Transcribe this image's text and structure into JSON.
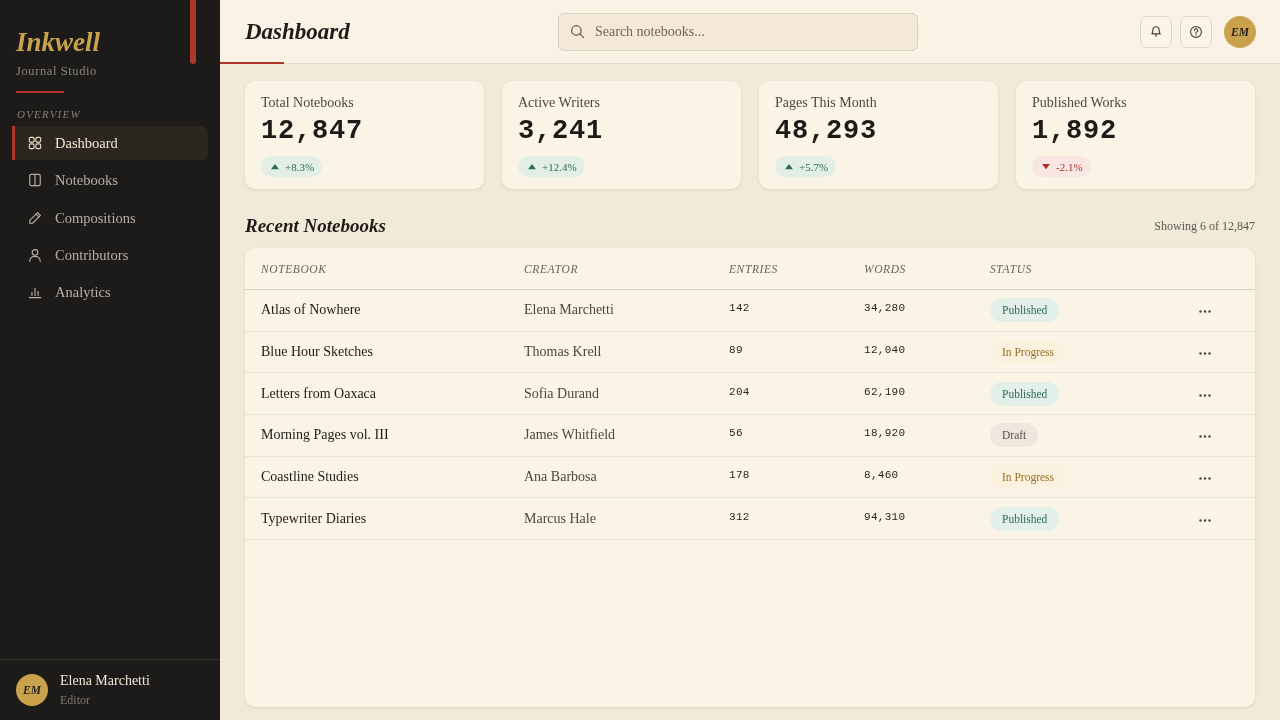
{
  "sidebar": {
    "logo": "Inkwell",
    "tagline": "Journal Studio",
    "section_label": "OVERVIEW",
    "items": [
      {
        "label": "Dashboard",
        "selected": true
      },
      {
        "label": "Notebooks",
        "selected": false
      },
      {
        "label": "Compositions",
        "selected": false
      },
      {
        "label": "Contributors",
        "selected": false
      },
      {
        "label": "Analytics",
        "selected": false
      }
    ],
    "user": {
      "initials": "EM",
      "name": "Elena Marchetti",
      "role": "Editor"
    }
  },
  "header": {
    "title": "Dashboard",
    "search": {
      "placeholder": "Search notebooks..."
    },
    "avatar": {
      "initials": "EM"
    }
  },
  "stats": [
    {
      "label": "Total Notebooks",
      "value": "12,847",
      "change": "+8.3%",
      "kind": "up"
    },
    {
      "label": "Active Writers",
      "value": "3,241",
      "change": "+12.4%",
      "kind": "up"
    },
    {
      "label": "Pages This Month",
      "value": "48,293",
      "change": "+5.7%",
      "kind": "up"
    },
    {
      "label": "Published Works",
      "value": "1,892",
      "change": "-2.1%",
      "kind": "down"
    }
  ],
  "recent": {
    "title": "Recent Notebooks",
    "summary": "Showing 6 of 12,847",
    "table": {
      "columns": [
        "NOTEBOOK",
        "CREATOR",
        "ENTRIES",
        "WORDS",
        "STATUS"
      ],
      "rows": [
        {
          "notebook": "Atlas of Nowhere",
          "creator": "Elena Marchetti",
          "entries": "142",
          "words": "34,280",
          "status": {
            "label": "Published",
            "kind": "published"
          }
        },
        {
          "notebook": "Blue Hour Sketches",
          "creator": "Thomas Krell",
          "entries": "89",
          "words": "12,040",
          "status": {
            "label": "In Progress",
            "kind": "progress"
          }
        },
        {
          "notebook": "Letters from Oaxaca",
          "creator": "Sofia Durand",
          "entries": "204",
          "words": "62,190",
          "status": {
            "label": "Published",
            "kind": "published"
          }
        },
        {
          "notebook": "Morning Pages vol. III",
          "creator": "James Whitfield",
          "entries": "56",
          "words": "18,920",
          "status": {
            "label": "Draft",
            "kind": "draft"
          }
        },
        {
          "notebook": "Coastline Studies",
          "creator": "Ana Barbosa",
          "entries": "178",
          "words": "8,460",
          "status": {
            "label": "In Progress",
            "kind": "progress"
          }
        },
        {
          "notebook": "Typewriter Diaries",
          "creator": "Marcus Hale",
          "entries": "312",
          "words": "94,310",
          "status": {
            "label": "Published",
            "kind": "published"
          }
        }
      ]
    }
  }
}
